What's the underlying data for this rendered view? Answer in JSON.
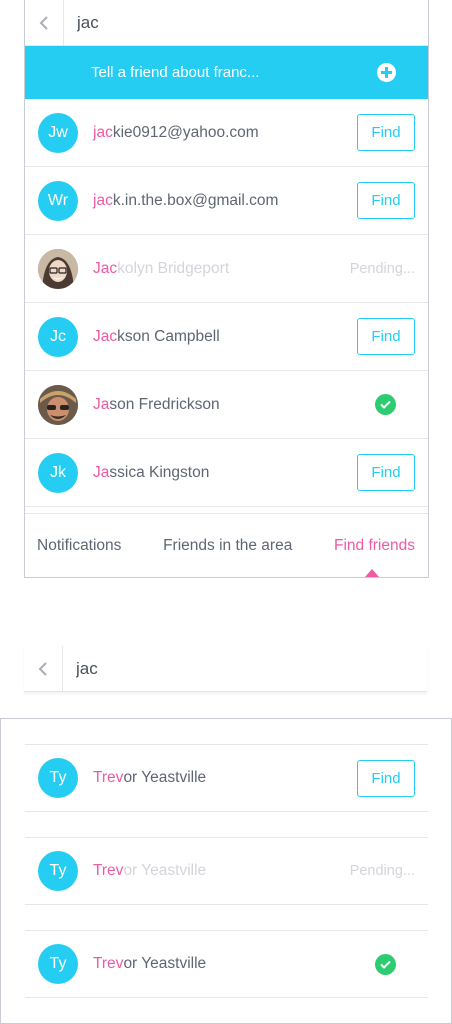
{
  "top": {
    "search": {
      "query": "jac"
    },
    "invite_banner": {
      "label": "Tell a friend about franc..."
    },
    "rows": [
      {
        "initials": "Jw",
        "highlight": "jac",
        "rest": "kie0912@yahoo.com",
        "action": "Find"
      },
      {
        "initials": "Wr",
        "highlight": "jac",
        "rest": "k.in.the.box@gmail.com",
        "action": "Find"
      },
      {
        "initials": "",
        "highlight": "Jac",
        "rest": "kolyn Bridgeport",
        "status": "Pending..."
      },
      {
        "initials": "Jc",
        "highlight": "Jac",
        "rest": "kson Campbell",
        "action": "Find"
      },
      {
        "initials": "",
        "highlight": "Ja",
        "rest": "son Fredrickson"
      },
      {
        "initials": "Jk",
        "highlight": "Ja",
        "rest": "ssica Kingston",
        "action": "Find"
      }
    ],
    "tabs": {
      "notifications": "Notifications",
      "friends_in_area": "Friends in the area",
      "find_friends": "Find friends"
    }
  },
  "middle": {
    "search": {
      "query": "jac"
    }
  },
  "bottom": {
    "rows": [
      {
        "initials": "Ty",
        "highlight": "Trev",
        "rest": "or Yeastville",
        "action": "Find"
      },
      {
        "initials": "Ty",
        "highlight": "Trev",
        "rest": "or Yeastville",
        "status": "Pending..."
      },
      {
        "initials": "Ty",
        "highlight": "Trev",
        "rest": "or Yeastville"
      }
    ]
  },
  "colors": {
    "accent": "#25cdf3",
    "highlight": "#ee5aa4",
    "success": "#2ecc71",
    "muted": "#d3d5db",
    "text": "#5e6673"
  },
  "icons": [
    "chevron-left-icon",
    "plus-circle-icon",
    "check-circle-icon"
  ]
}
